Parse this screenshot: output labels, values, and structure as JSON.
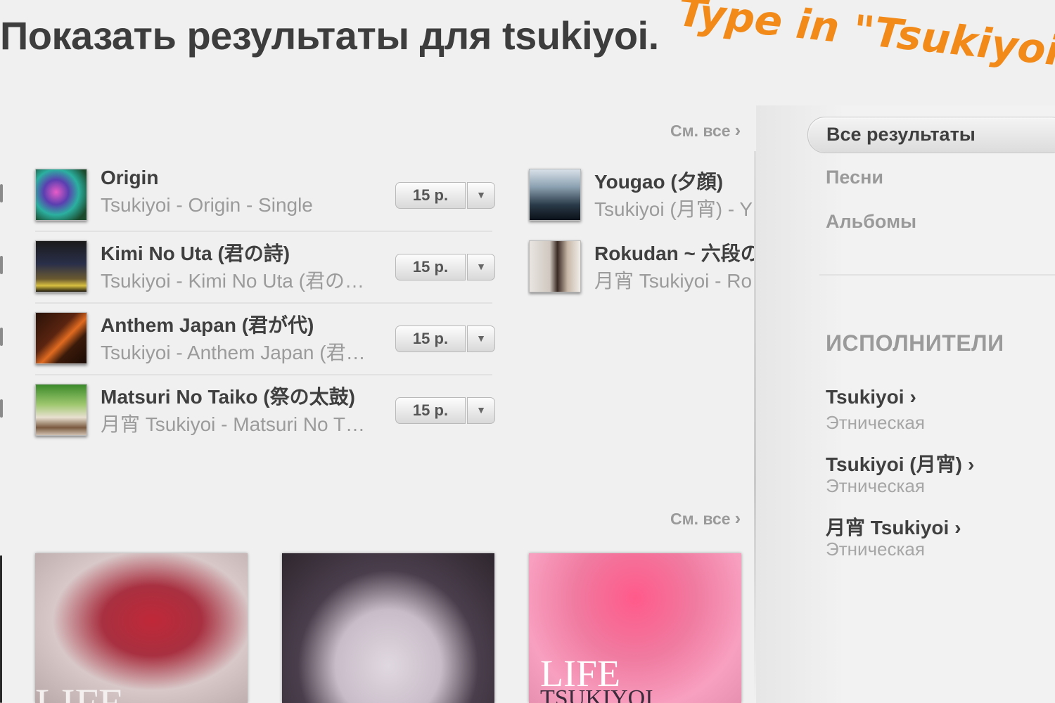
{
  "header": {
    "title": "Показать результаты для tsukiyoi.",
    "annotation": "Type in \"Tsukiyoi\""
  },
  "songs_section": {
    "see_all": "См. все",
    "left_column": [
      {
        "title": "Origin",
        "subtitle": "Tsukiyoi - Origin - Single",
        "price": "15 р."
      },
      {
        "title": "Kimi No Uta (君の詩)",
        "subtitle": "Tsukiyoi - Kimi No Uta (君の…",
        "price": "15 р."
      },
      {
        "title": "Anthem Japan (君が代)",
        "subtitle": "Tsukiyoi - Anthem Japan (君…",
        "price": "15 р."
      },
      {
        "title": "Matsuri No Taiko (祭の太鼓)",
        "subtitle": "月宵 Tsukiyoi - Matsuri No T…",
        "price": "15 р."
      }
    ],
    "right_column": [
      {
        "title": "Yougao (夕顔)",
        "subtitle": "Tsukiyoi (月宵) - Y"
      },
      {
        "title": "Rokudan ~ 六段の",
        "subtitle": "月宵 Tsukiyoi - Ro"
      }
    ]
  },
  "albums_section": {
    "see_all": "См. все",
    "albums": [
      {
        "cover_text": "LIFE",
        "color": "#c03040"
      },
      {
        "cover_text": "",
        "color": "#7a6f7d"
      },
      {
        "cover_text": "LIFE",
        "cover_subtext": "TSUKIYOI",
        "color": "#f07aa0"
      }
    ]
  },
  "sidebar": {
    "filters": [
      {
        "label": "Все результаты",
        "selected": true
      },
      {
        "label": "Песни",
        "selected": false
      },
      {
        "label": "Альбомы",
        "selected": false
      }
    ],
    "artists_heading": "ИСПОЛНИТЕЛИ",
    "artists": [
      {
        "name": "Tsukiyoi",
        "genre": "Этническая"
      },
      {
        "name": "Tsukiyoi (月宵)",
        "genre": "Этническая"
      },
      {
        "name": "月宵 Tsukiyoi",
        "genre": "Этническая"
      }
    ]
  },
  "icons": {
    "chevron_right": "chevron-right-icon",
    "dropdown_arrow": "triangle-down-icon"
  },
  "colors": {
    "annotation": "#f28a1a",
    "text_primary": "#3f3f3f",
    "text_secondary": "#9b9b9b"
  }
}
